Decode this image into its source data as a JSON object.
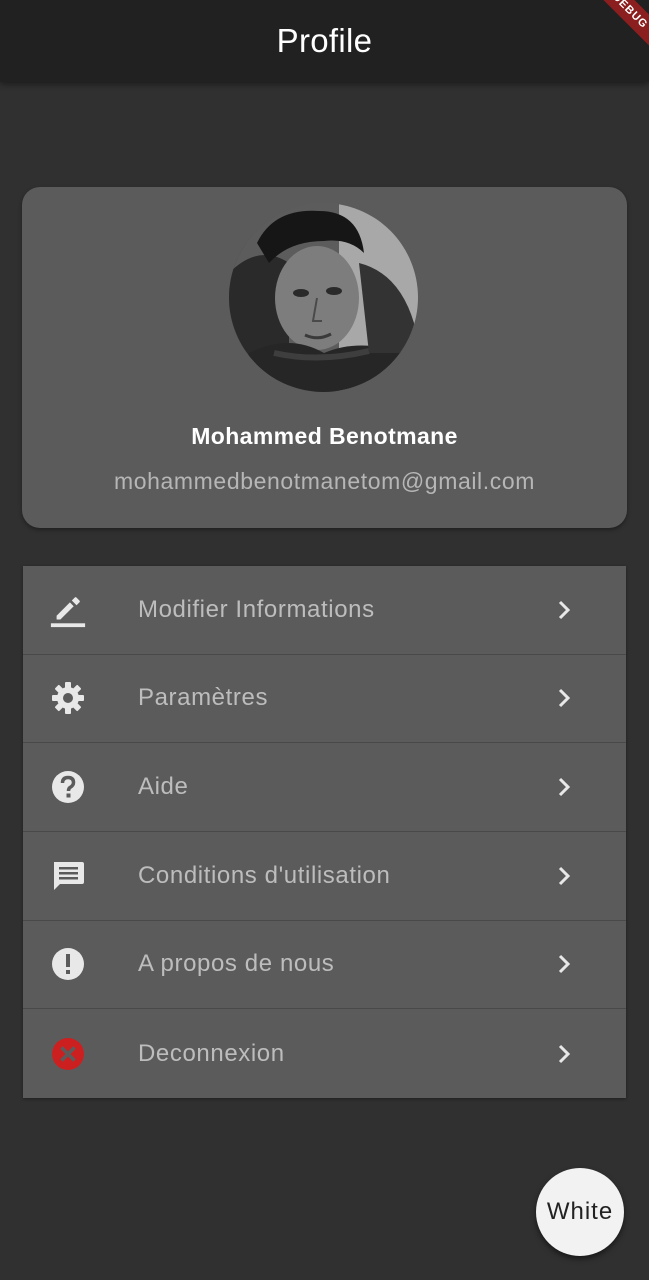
{
  "appbar": {
    "title": "Profile",
    "debug_banner": "DEBUG"
  },
  "profile": {
    "name": "Mohammed Benotmane",
    "email": "mohammedbenotmanetom@gmail.com",
    "avatar_icon": "profile-photo"
  },
  "menu": {
    "items": [
      {
        "label": "Modifier Informations",
        "icon": "edit-icon"
      },
      {
        "label": "Paramètres",
        "icon": "settings-gear-icon"
      },
      {
        "label": "Aide",
        "icon": "help-icon"
      },
      {
        "label": "Conditions d'utilisation",
        "icon": "chat-icon"
      },
      {
        "label": "A propos de nous",
        "icon": "info-exclamation-icon"
      },
      {
        "label": "Deconnexion",
        "icon": "logout-cancel-icon"
      }
    ]
  },
  "fab": {
    "label": "White"
  },
  "colors": {
    "background": "#303030",
    "appbar": "#212121",
    "card": "#5b5b5b",
    "icon": "#e8e8e8",
    "logout_icon": "#cc2020",
    "debug_banner": "#8b1e1e"
  }
}
